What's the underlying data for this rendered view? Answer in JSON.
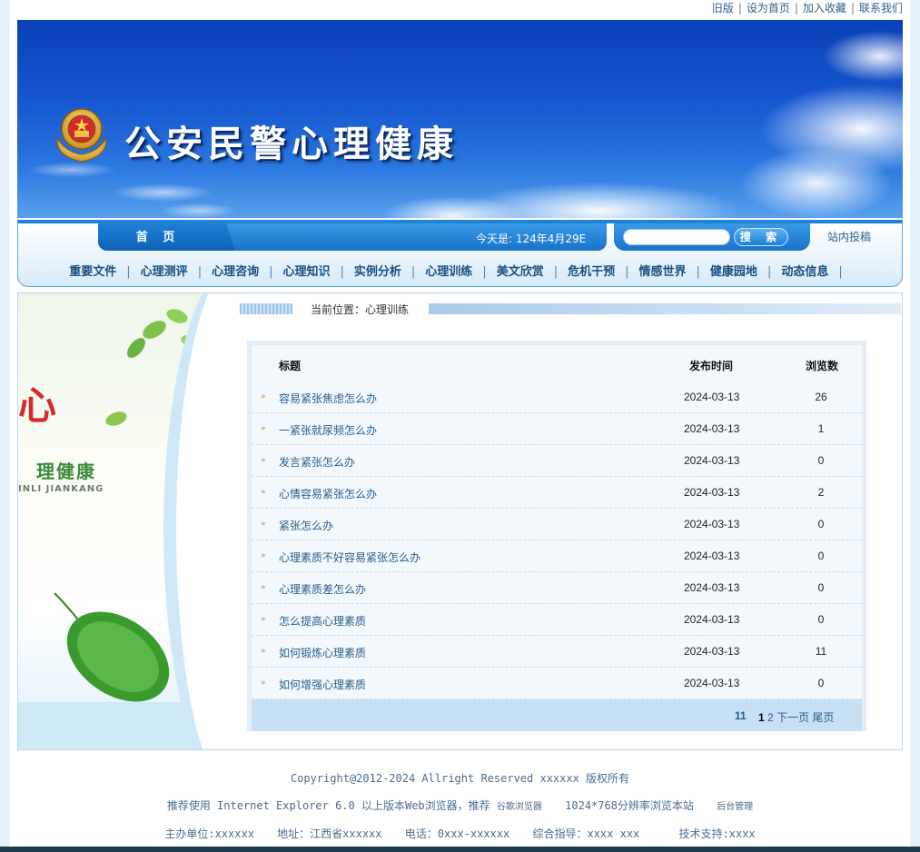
{
  "top_links": [
    "旧版",
    "设为首页",
    "加入收藏",
    "联系我们"
  ],
  "site": {
    "title": "公安民警心理健康"
  },
  "nav": {
    "home": "首 页",
    "today": "今天是: 124年4月29E",
    "search_placeholder": "",
    "search_button": "搜 索",
    "submit": "站内投稿",
    "menu": [
      "重要文件",
      "心理测评",
      "心理咨询",
      "心理知识",
      "实例分析",
      "心理训练",
      "美文欣赏",
      "危机干预",
      "情感世界",
      "健康园地",
      "动态信息"
    ]
  },
  "side": {
    "heart_char": "心",
    "text1": "理健康",
    "text2": "INLI JIANKANG"
  },
  "breadcrumb": "当前位置：心理训练",
  "list": {
    "headers": {
      "title": "标题",
      "date": "发布时间",
      "views": "浏览数"
    },
    "rows": [
      {
        "title": "容易紧张焦虑怎么办",
        "date": "2024-03-13",
        "views": "26"
      },
      {
        "title": "一紧张就尿频怎么办",
        "date": "2024-03-13",
        "views": "1"
      },
      {
        "title": "发言紧张怎么办",
        "date": "2024-03-13",
        "views": "0"
      },
      {
        "title": "心情容易紧张怎么办",
        "date": "2024-03-13",
        "views": "2"
      },
      {
        "title": "紧张怎么办",
        "date": "2024-03-13",
        "views": "0"
      },
      {
        "title": "心理素质不好容易紧张怎么办",
        "date": "2024-03-13",
        "views": "0"
      },
      {
        "title": "心理素质差怎么办",
        "date": "2024-03-13",
        "views": "0"
      },
      {
        "title": "怎么提高心理素质",
        "date": "2024-03-13",
        "views": "0"
      },
      {
        "title": "如何锻炼心理素质",
        "date": "2024-03-13",
        "views": "11"
      },
      {
        "title": "如何增强心理素质",
        "date": "2024-03-13",
        "views": "0"
      }
    ],
    "pager": {
      "total": "11",
      "current": "1",
      "next_page": "2",
      "next_label": "下一页",
      "last_label": "尾页"
    }
  },
  "footer": {
    "copyright": "Copyright@2012-2024 Allright Reserved xxxxxx 版权所有",
    "recommend_1": "推荐使用  Internet Explorer 6.0  以上版本Web浏览器，推荐",
    "recommend_browser": "谷歌浏览器",
    "recommend_2": "1024*768分辨率浏览本站",
    "admin": "后台管理",
    "host": "主办单位:xxxxxx",
    "address": "地址：江西省xxxxxx",
    "phone": "电话：0xxx-xxxxxx",
    "guide": "综合指导：xxxx  xxx",
    "support": "技术支持:xxxx"
  }
}
